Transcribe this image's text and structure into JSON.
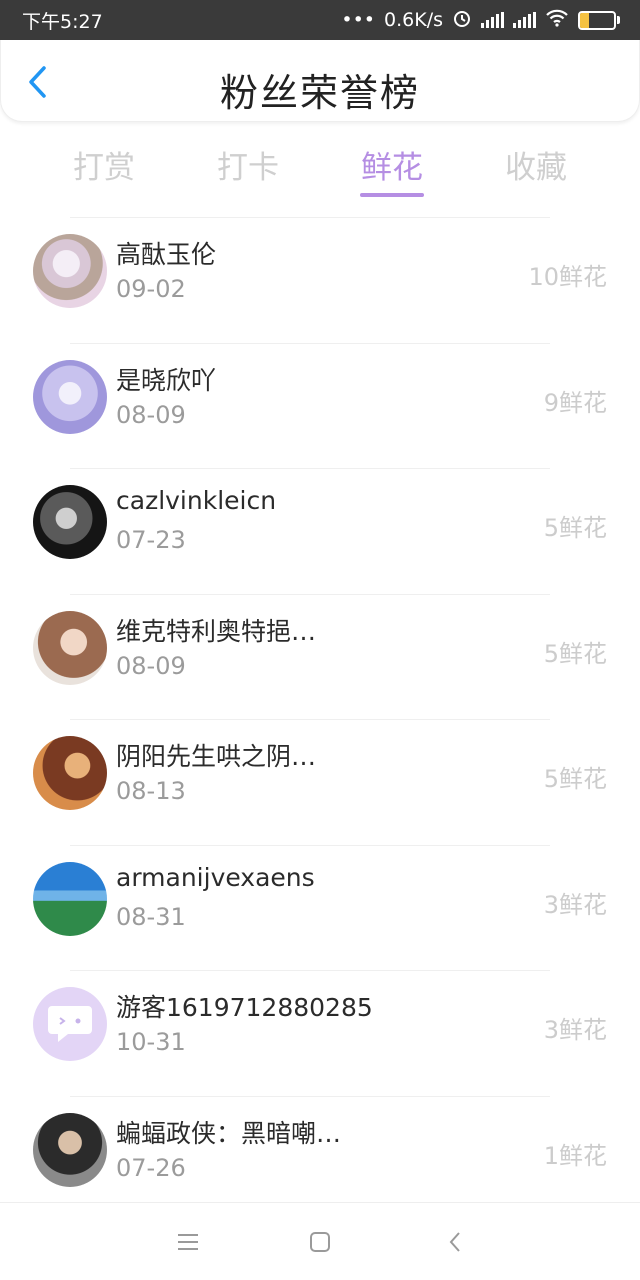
{
  "status": {
    "time": "下午5:27",
    "network": "0.6K/s",
    "battery": "27",
    "battery_level": 0.27
  },
  "header": {
    "title": "粉丝荣誉榜"
  },
  "tabs": [
    {
      "label": "打赏",
      "active": false
    },
    {
      "label": "打卡",
      "active": false
    },
    {
      "label": "鲜花",
      "active": true
    },
    {
      "label": "收藏",
      "active": false
    }
  ],
  "fans": [
    {
      "name": "高酞玉伦",
      "date": "09-02",
      "count": "10鲜花"
    },
    {
      "name": "是晓欣吖",
      "date": "08-09",
      "count": "9鲜花"
    },
    {
      "name": "cazlvinkleicn",
      "date": "07-23",
      "count": "5鲜花"
    },
    {
      "name": "维克特利奥特挹…",
      "date": "08-09",
      "count": "5鲜花"
    },
    {
      "name": "阴阳先生哄之阴…",
      "date": "08-13",
      "count": "5鲜花"
    },
    {
      "name": "armanijvexaens",
      "date": "08-31",
      "count": "3鲜花"
    },
    {
      "name": "游客1619712880285",
      "date": "10-31",
      "count": "3鲜花"
    },
    {
      "name": "蝙蝠政侠：黑暗嘲…",
      "date": "07-26",
      "count": "1鲜花"
    }
  ],
  "colors": {
    "accent": "#b58ee3",
    "back_arrow": "#2196f3"
  },
  "icons": {
    "back": "back-arrow-icon",
    "menu": "menu-icon",
    "home": "home-icon",
    "nav_back": "nav-back-icon"
  }
}
